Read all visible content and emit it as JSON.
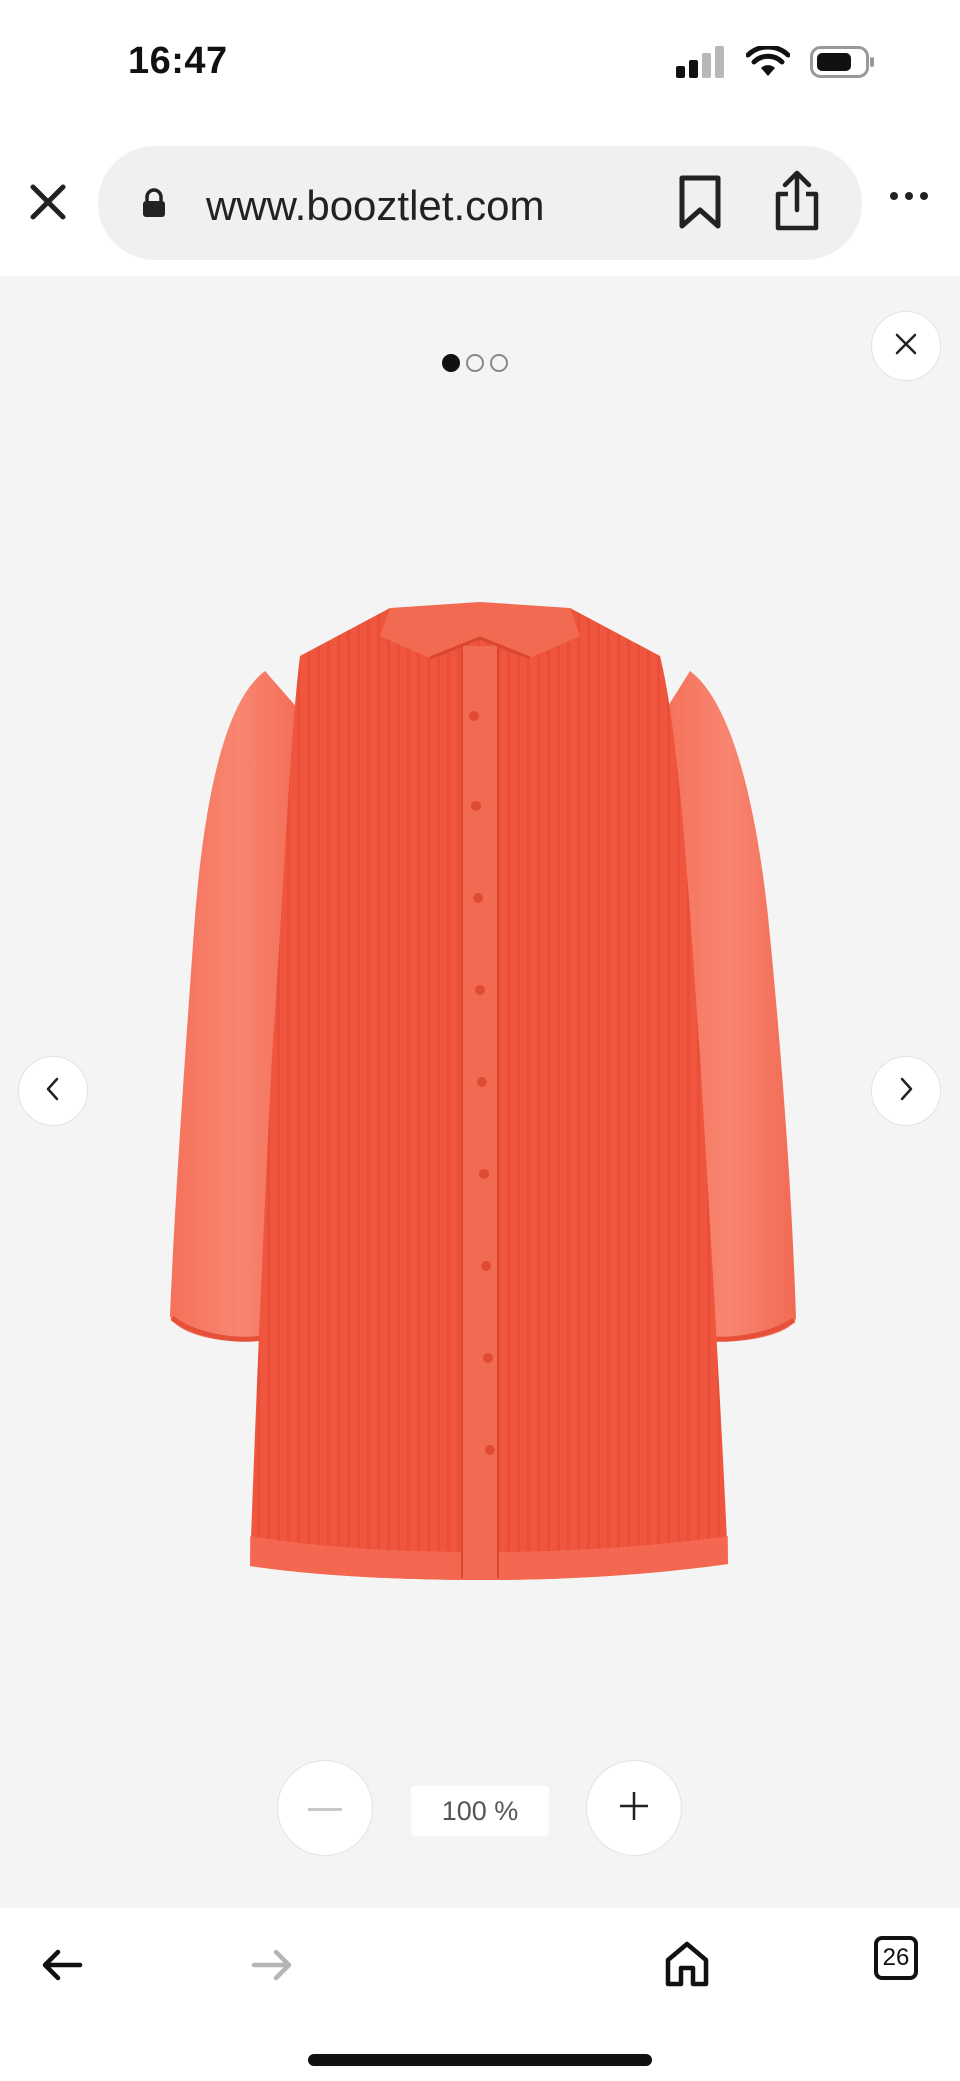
{
  "status_bar": {
    "time": "16:47",
    "icons": [
      "signal-icon",
      "wifi-icon",
      "battery-icon"
    ]
  },
  "browser": {
    "url": "www.booztlet.com",
    "icons": [
      "close-icon",
      "lock-icon",
      "bookmark-icon",
      "share-icon",
      "more-icon"
    ]
  },
  "viewer": {
    "image_count": 3,
    "active_image": 1,
    "product_color": "#f0563e",
    "zoom": {
      "level_label": "100 %",
      "minus_enabled": false,
      "plus_enabled": true
    },
    "icons": [
      "close-icon",
      "chevron-left-icon",
      "chevron-right-icon",
      "minus-icon",
      "plus-icon"
    ]
  },
  "toolbar": {
    "tab_count": "26",
    "forward_enabled": false,
    "icons": [
      "back-arrow-icon",
      "forward-arrow-icon",
      "home-icon",
      "tabs-icon"
    ]
  },
  "colors": {
    "viewer_background": "#f4f4f4",
    "url_pill": "#eef0f1",
    "disabled": "#b5b5b5"
  }
}
